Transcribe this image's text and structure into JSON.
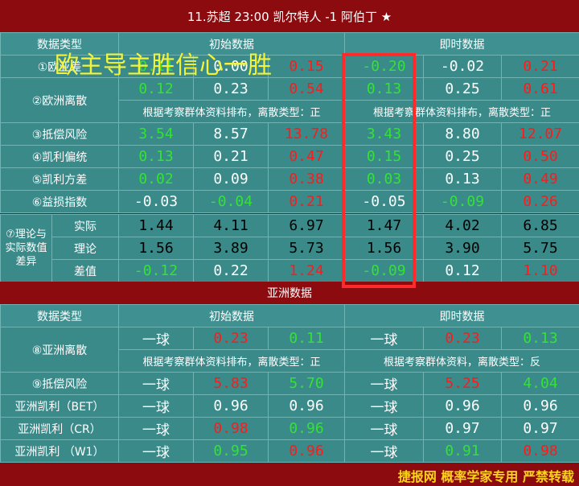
{
  "header": {
    "title": "11.苏超 23:00  凯尔特人 -1 阿伯丁 ★"
  },
  "overlay_text": "欧主导主胜信心一胜",
  "euro": {
    "col_type": "数据类型",
    "col_initial": "初始数据",
    "col_instant": "即时数据",
    "rows": {
      "r1": {
        "label": "①欧亚差",
        "init": [
          "0.11",
          "0.00",
          "0.15"
        ],
        "inst": [
          "-0.20",
          "-0.02",
          "0.21"
        ]
      },
      "r2": {
        "label": "②欧洲离散",
        "init": [
          "0.12",
          "0.23",
          "0.54"
        ],
        "inst": [
          "0.13",
          "0.25",
          "0.61"
        ],
        "note_init": "根据考察群体资料排布，离散类型：正",
        "note_inst": "根据考察群体资料排布，离散类型：正"
      },
      "r3": {
        "label": "③抵偿风险",
        "init": [
          "3.54",
          "8.57",
          "13.78"
        ],
        "inst": [
          "3.43",
          "8.80",
          "12.07"
        ]
      },
      "r4": {
        "label": "④凯利偏统",
        "init": [
          "0.13",
          "0.21",
          "0.47"
        ],
        "inst": [
          "0.15",
          "0.25",
          "0.50"
        ]
      },
      "r5": {
        "label": "⑤凯利方差",
        "init": [
          "0.02",
          "0.09",
          "0.38"
        ],
        "inst": [
          "0.03",
          "0.13",
          "0.49"
        ]
      },
      "r6": {
        "label": "⑥益损指数",
        "init": [
          "-0.03",
          "-0.04",
          "0.21"
        ],
        "inst": [
          "-0.05",
          "-0.09",
          "0.26"
        ]
      }
    },
    "r7": {
      "label": "⑦理论与实际数值差异",
      "actual": {
        "label": "实际",
        "init": [
          "1.44",
          "4.11",
          "6.97"
        ],
        "inst": [
          "1.47",
          "4.02",
          "6.85"
        ]
      },
      "theory": {
        "label": "理论",
        "init": [
          "1.56",
          "3.89",
          "5.73"
        ],
        "inst": [
          "1.56",
          "3.90",
          "5.75"
        ]
      },
      "diff": {
        "label": "差值",
        "init": [
          "-0.12",
          "0.22",
          "1.24"
        ],
        "inst": [
          "-0.09",
          "0.12",
          "1.10"
        ]
      }
    }
  },
  "asia": {
    "section_title": "亚洲数据",
    "col_type": "数据类型",
    "col_initial": "初始数据",
    "col_instant": "即时数据",
    "r8": {
      "label": "⑧亚洲离散",
      "init": [
        "一球",
        "0.23",
        "0.11"
      ],
      "inst": [
        "一球",
        "0.23",
        "0.13"
      ],
      "note_init": "根据考察群体资料排布，离散类型：正",
      "note_inst": "根据考察群体资料，离散类型：反"
    },
    "r9": {
      "label": "⑨抵偿风险",
      "init": [
        "一球",
        "5.83",
        "5.70"
      ],
      "inst": [
        "一球",
        "5.25",
        "4.04"
      ]
    },
    "bet": {
      "label": "亚洲凯利（BET）",
      "init": [
        "一球",
        "0.96",
        "0.96"
      ],
      "inst": [
        "一球",
        "0.96",
        "0.96"
      ]
    },
    "cr": {
      "label": "亚洲凯利（CR）",
      "init": [
        "一球",
        "0.98",
        "0.96"
      ],
      "inst": [
        "一球",
        "0.97",
        "0.97"
      ]
    },
    "w1": {
      "label": "亚洲凯利 （W1）",
      "init": [
        "一球",
        "0.95",
        "0.96"
      ],
      "inst": [
        "一球",
        "0.91",
        "0.98"
      ]
    }
  },
  "footer": {
    "text": "捷报网 概率学家专用 严禁转载"
  },
  "colors": {
    "bg": "#8b0b0e",
    "table": "#3a8a8a",
    "green": "#33e233",
    "red": "#ff1a1a",
    "highlight": "#ff2a2a",
    "overlay": "#f3f33a"
  }
}
